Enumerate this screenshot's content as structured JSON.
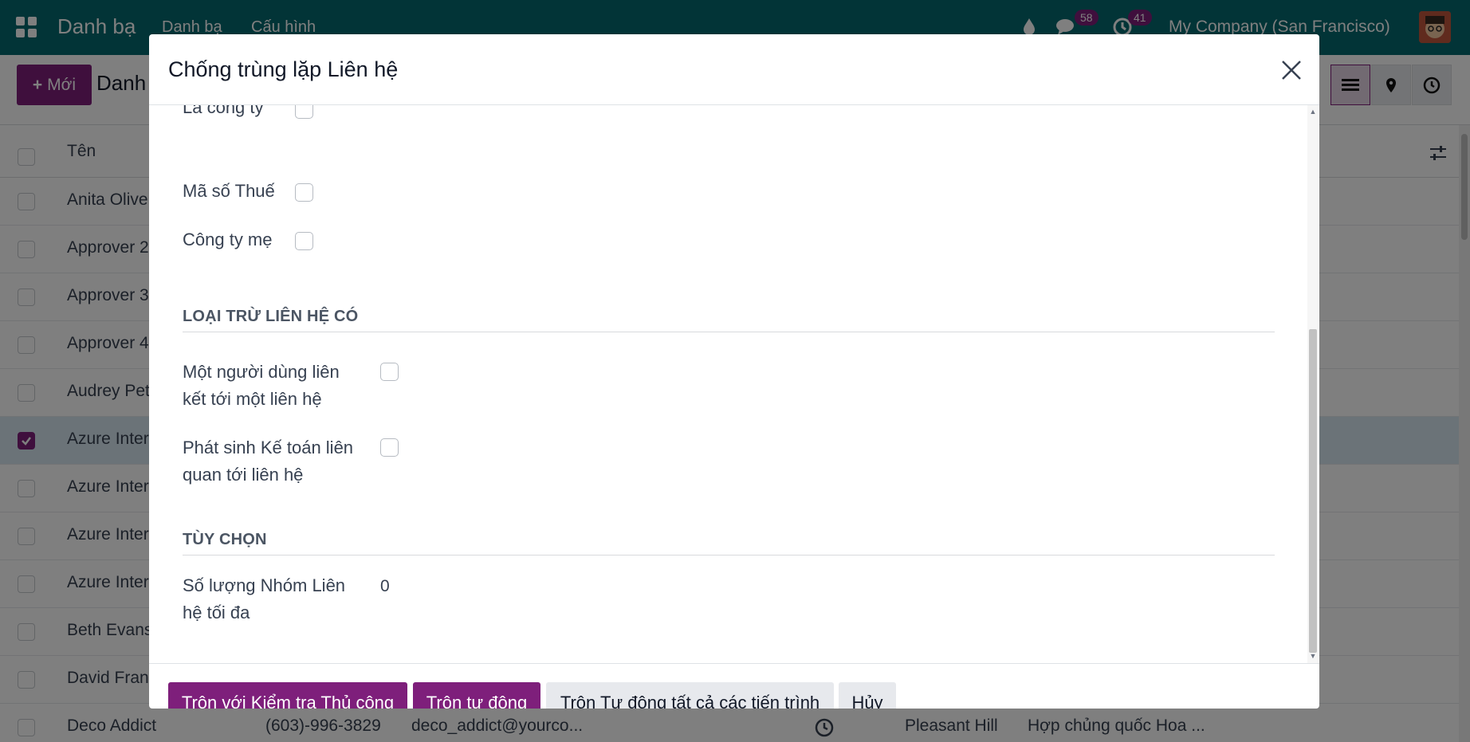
{
  "navbar": {
    "app_name": "Danh bạ",
    "menu": [
      "Danh bạ",
      "Cấu hình"
    ],
    "messages_count": "58",
    "activities_count": "41",
    "company": "My Company (San Francisco)"
  },
  "control_panel": {
    "new_button": "Mới",
    "title": "Danh"
  },
  "list": {
    "header_name": "Tên",
    "rows": [
      {
        "name": "Anita Olive",
        "checked": false
      },
      {
        "name": "Approver 2",
        "checked": false
      },
      {
        "name": "Approver 3",
        "checked": false
      },
      {
        "name": "Approver 4",
        "checked": false
      },
      {
        "name": "Audrey Pet",
        "checked": false
      },
      {
        "name": "Azure Inter",
        "checked": true
      },
      {
        "name": "Azure Inter",
        "checked": false
      },
      {
        "name": "Azure Inter",
        "checked": false
      },
      {
        "name": "Azure Inter",
        "checked": false
      },
      {
        "name": "Beth Evans",
        "checked": false
      },
      {
        "name": "David Fran",
        "checked": false
      },
      {
        "name": "Deco Addict",
        "checked": false,
        "phone": "(603)-996-3829",
        "email": "deco_addict@yourco...",
        "city": "Pleasant Hill",
        "country": "Hợp chủng quốc Hoa ..."
      }
    ]
  },
  "modal": {
    "title": "Chống trùng lặp Liên hệ",
    "fields_top": [
      {
        "label": "Là công ty"
      },
      {
        "label": "Mã số Thuế"
      },
      {
        "label": "Công ty mẹ"
      }
    ],
    "exclude_section": {
      "title": "LOẠI TRỪ LIÊN HỆ CÓ",
      "fields": [
        {
          "label_line1": "Một người dùng liên",
          "label_line2": "kết tới một liên hệ"
        },
        {
          "label_line1": "Phát sinh Kế toán liên",
          "label_line2": "quan tới liên hệ"
        }
      ]
    },
    "options_section": {
      "title": "TÙY CHỌN",
      "max_groups_label_line1": "Số lượng Nhóm Liên",
      "max_groups_label_line2": "hệ tối đa",
      "max_groups_value": "0"
    },
    "buttons": {
      "manual": "Trộn với Kiểm tra Thủ công",
      "auto": "Trộn tự động",
      "auto_all": "Trộn Tự động tất cả các tiến trình",
      "cancel": "Hủy"
    }
  },
  "colors": {
    "navbar": "#04686f",
    "primary": "#7e1f7b",
    "selected_row": "#d7e6f1"
  }
}
